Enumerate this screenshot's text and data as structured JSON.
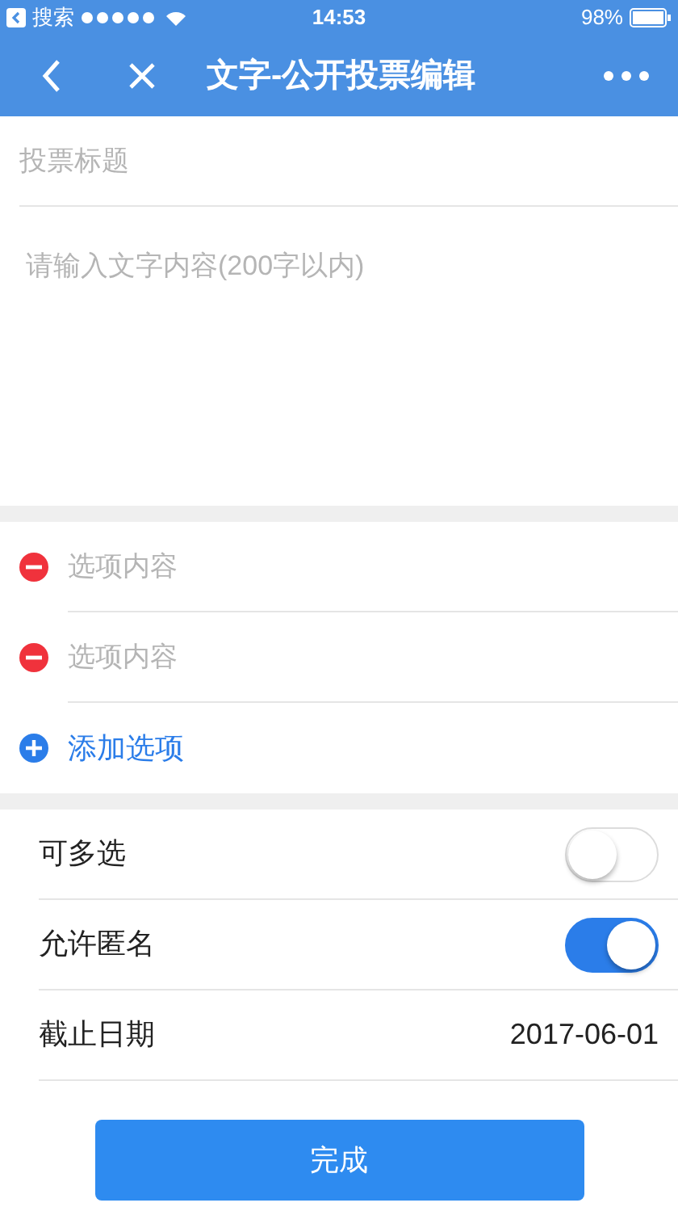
{
  "status_bar": {
    "back_label": "搜索",
    "time": "14:53",
    "battery": "98%"
  },
  "nav": {
    "title": "文字-公开投票编辑"
  },
  "title_field": {
    "placeholder": "投票标题"
  },
  "content_field": {
    "placeholder": "请输入文字内容(200字以内)"
  },
  "options": [
    {
      "placeholder": "选项内容"
    },
    {
      "placeholder": "选项内容"
    }
  ],
  "add_option": "添加选项",
  "settings": [
    {
      "kind": "toggle",
      "label": "可多选",
      "on": false
    },
    {
      "kind": "toggle",
      "label": "允许匿名",
      "on": true
    },
    {
      "kind": "value",
      "label": "截止日期",
      "value": "2017-06-01"
    }
  ],
  "submit": "完成"
}
